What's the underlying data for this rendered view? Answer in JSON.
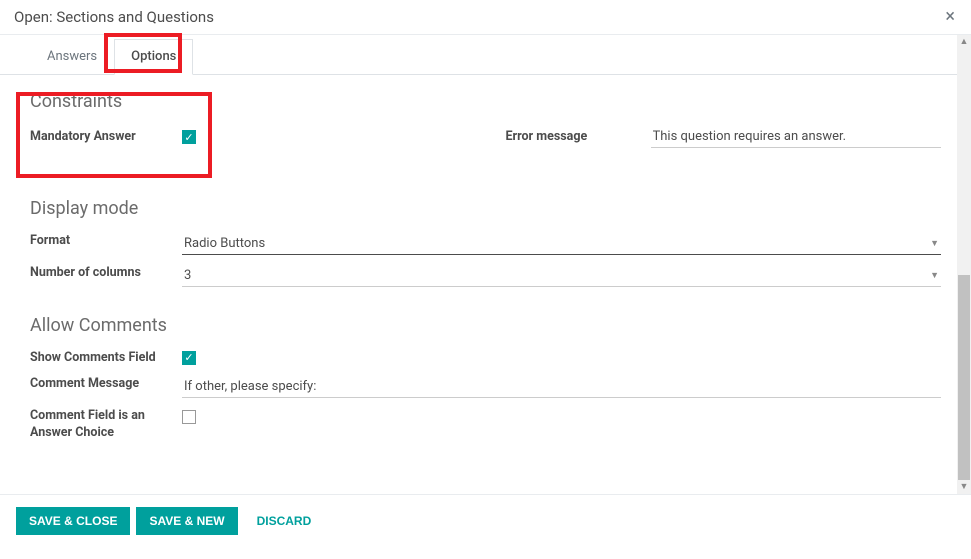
{
  "header": {
    "title": "Open: Sections and Questions",
    "close_icon": "×"
  },
  "tabs": {
    "answers": "Answers",
    "options": "Options"
  },
  "constraints": {
    "title": "Constraints",
    "mandatory_label": "Mandatory Answer",
    "mandatory_checked": true,
    "error_label": "Error message",
    "error_value": "This question requires an answer."
  },
  "display_mode": {
    "title": "Display mode",
    "format_label": "Format",
    "format_value": "Radio Buttons",
    "columns_label": "Number of columns",
    "columns_value": "3"
  },
  "allow_comments": {
    "title": "Allow Comments",
    "show_field_label": "Show Comments Field",
    "show_field_checked": true,
    "message_label": "Comment Message",
    "message_value": "If other, please specify:",
    "answer_choice_label": "Comment Field is an Answer Choice",
    "answer_choice_checked": false
  },
  "footer": {
    "save_close": "Save & Close",
    "save_new": "Save & New",
    "discard": "Discard"
  }
}
